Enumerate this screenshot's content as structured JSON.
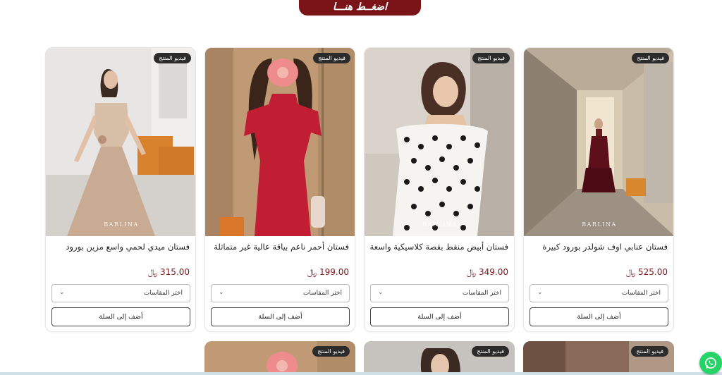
{
  "cta": {
    "label": "اضغــط هنـــا"
  },
  "products": [
    {
      "badge": "فيديو المنتج",
      "watermark": "BARLINA",
      "title": "فستان عنابي اوف شولدر بورود كبيرة",
      "price": "525.00",
      "currency": "⃁",
      "size_placeholder": "اختر المقاسات",
      "add_label": "أضف إلى السلة"
    },
    {
      "badge": "فيديو المنتج",
      "watermark": "BARLINA",
      "title": "فستان أبيض منقط بقصة كلاسيكية واسعة",
      "price": "349.00",
      "currency": "⃁",
      "size_placeholder": "اختر المقاسات",
      "add_label": "أضف إلى السلة"
    },
    {
      "badge": "فيديو المنتج",
      "watermark": "",
      "title": "فستان أحمر ناعم بياقة عالية غير متماثلة",
      "price": "199.00",
      "currency": "⃁",
      "size_placeholder": "اختر المقاسات",
      "add_label": "أضف إلى السلة"
    },
    {
      "badge": "فيديو المنتج",
      "watermark": "BARLINA",
      "title": "فستان ميدي لحمي واسع مزين بورود",
      "price": "315.00",
      "currency": "⃁",
      "size_placeholder": "اختر المقاسات",
      "add_label": "أضف إلى السلة"
    }
  ],
  "next_row_badges": [
    "فيديو المنتج",
    "فيديو المنتج",
    "فيديو المنتج"
  ],
  "colors": {
    "brand": "#7b1419",
    "whatsapp": "#25d366"
  }
}
